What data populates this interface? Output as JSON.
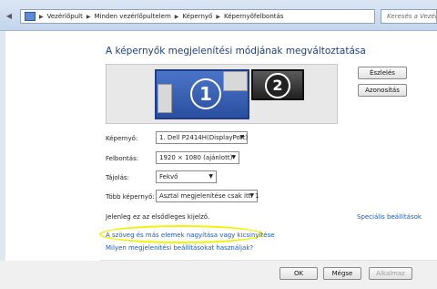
{
  "breadcrumb": {
    "items": [
      "Vezérlőpult",
      "Minden vezérlőpultelem",
      "Képernyő",
      "Képernyőfelbontás"
    ]
  },
  "search": {
    "placeholder": "Keresés a Vezérlőpulton"
  },
  "page": {
    "title": "A képernyők megjelenítési módjának megváltoztatása"
  },
  "monitors": {
    "primary": "1",
    "secondary": "2"
  },
  "buttons": {
    "detect": "Észlelés",
    "identify": "Azonosítás",
    "ok": "OK",
    "cancel": "Mégse",
    "apply": "Alkalmaz"
  },
  "settings": {
    "display_label": "Képernyő:",
    "display_value": "1. Dell P2414H(DisplayPort)",
    "resolution_label": "Felbontás:",
    "resolution_value": "1920 × 1080 (ajánlott)",
    "orientation_label": "Tájolás:",
    "orientation_value": "Fekvő",
    "multi_label": "Több képernyő:",
    "multi_value": "Asztal megjelenítése csak itt: 1"
  },
  "status": {
    "primary_text": "Jelenleg ez az elsődleges kijelző."
  },
  "links": {
    "advanced": "Speciális beállítások",
    "text_size": "A szöveg és más elemek nagyítása vagy kicsinyítése",
    "which_settings": "Milyen megjelenítési beállításokat használjak?"
  }
}
